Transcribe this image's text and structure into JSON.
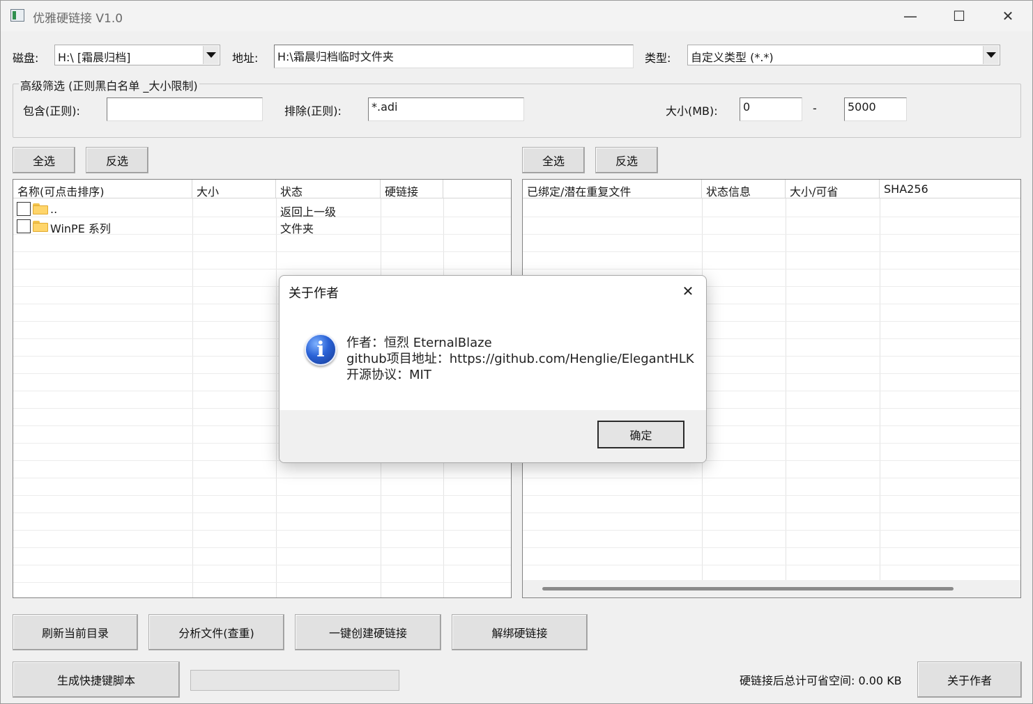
{
  "window": {
    "title": "优雅硬链接 V1.0",
    "controls": {
      "minimize": "—",
      "maximize": "☐",
      "close": "✕"
    }
  },
  "toolbar": {
    "disk_label": "磁盘:",
    "disk_value": "H:\\ [霜晨归档]",
    "address_label": "地址:",
    "address_value": "H:\\霜晨归档临时文件夹",
    "type_label": "类型:",
    "type_value": "自定义类型 (*.*)"
  },
  "filter": {
    "title": "高级筛选 (正则黑白名单 _大小限制)",
    "include_label": "包含(正则):",
    "include_value": "",
    "exclude_label": "排除(正则):",
    "exclude_value": "*.adi",
    "size_label": "大小(MB):",
    "size_min": "0",
    "size_sep": "-",
    "size_max": "5000"
  },
  "left_panel": {
    "select_all": "全选",
    "invert": "反选",
    "columns": [
      "名称(可点击排序)",
      "大小",
      "状态",
      "硬链接"
    ],
    "rows": [
      {
        "name": "..",
        "size": "",
        "status": "返回上一级",
        "hardlink": ""
      },
      {
        "name": "WinPE 系列",
        "size": "",
        "status": "文件夹",
        "hardlink": ""
      }
    ]
  },
  "right_panel": {
    "select_all": "全选",
    "invert": "反选",
    "columns": [
      "已绑定/潜在重复文件",
      "状态信息",
      "大小/可省",
      "SHA256"
    ]
  },
  "actions": {
    "refresh": "刷新当前目录",
    "analyze": "分析文件(查重)",
    "create": "一键创建硬链接",
    "unbind": "解绑硬链接",
    "script": "生成快捷键脚本",
    "saved_space": "硬链接后总计可省空间: 0.00 KB",
    "about": "关于作者"
  },
  "dialog": {
    "title": "关于作者",
    "close": "✕",
    "icon": "i",
    "line1": "作者：恒烈 EternalBlaze",
    "line2": "github项目地址：https://github.com/Henglie/ElegantHLK",
    "line3": "开源协议：MIT",
    "ok": "确定"
  }
}
